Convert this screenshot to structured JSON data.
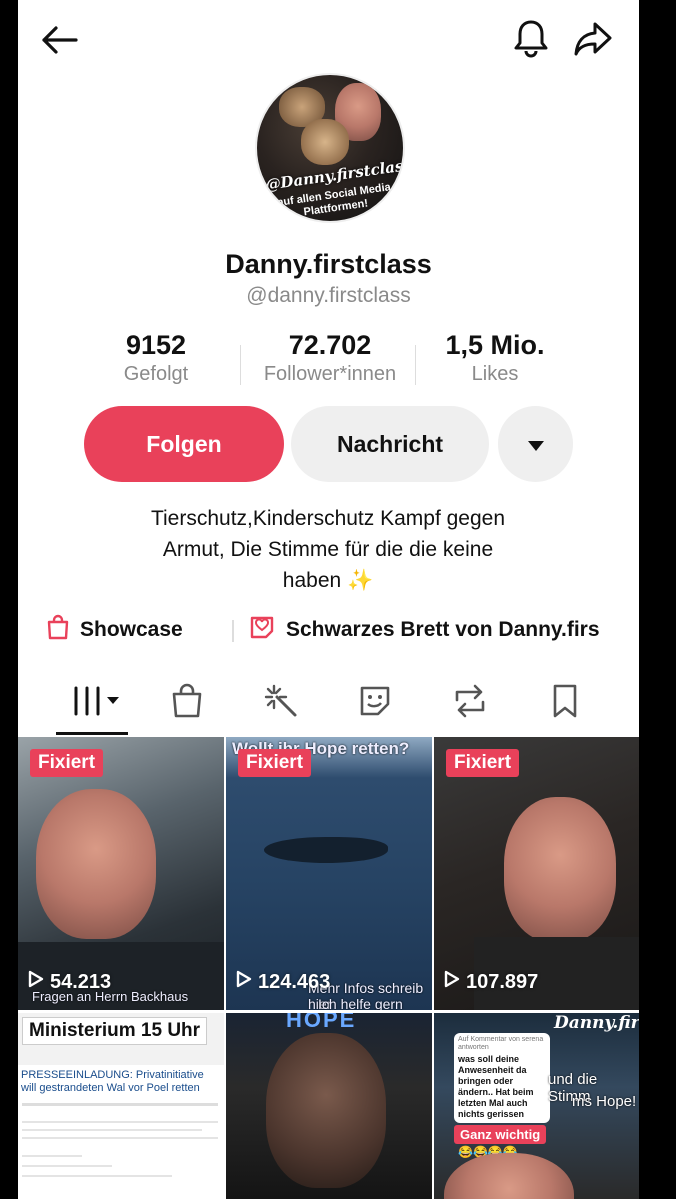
{
  "header": {
    "back_icon": "arrow-left-icon",
    "bell_icon": "bell-icon",
    "share_icon": "share-arrow-icon"
  },
  "profile": {
    "avatar_logo_text": "@Danny.firstclass",
    "avatar_sub_text": "auf allen Social Media Plattformen!",
    "display_name": "Danny.firstclass",
    "handle": "@danny.firstclass"
  },
  "stats": [
    {
      "value": "9152",
      "label": "Gefolgt"
    },
    {
      "value": "72.702",
      "label": "Follower*innen"
    },
    {
      "value": "1,5 Mio.",
      "label": "Likes"
    }
  ],
  "actions": {
    "follow_label": "Folgen",
    "message_label": "Nachricht",
    "more_icon": "caret-down-icon"
  },
  "bio": {
    "line1": "Tierschutz,Kinderschutz Kampf gegen",
    "line2": "Armut,  Die Stimme für die die keine",
    "line3": "haben ✨"
  },
  "links": {
    "showcase_label": "Showcase",
    "board_label": "Schwarzes Brett von Danny.firs"
  },
  "tabs": [
    "videos-grid-icon",
    "shopping-bag-icon",
    "sparkle-wand-icon",
    "sticker-icon",
    "repost-icon",
    "bookmark-icon"
  ],
  "videos": [
    {
      "pinned": "Fixiert",
      "views": "54.213",
      "caption": "Fragen an Herrn Backhaus"
    },
    {
      "pinned": "Fixiert",
      "views": "124.463",
      "caption_top": "Wollt ihr Hope retten?",
      "caption": "Mehr Infos schreib hier",
      "caption2": "Ich helfe gern"
    },
    {
      "pinned": "Fixiert",
      "views": "107.897"
    },
    {
      "title": "Ministerium 15 Uhr",
      "doc_heading": "PRESSEEINLADUNG: Privatinitiative will gestrandeten Wal vor Poel retten"
    },
    {
      "caption_top": "HOPE"
    },
    {
      "comment_header": "Auf Kommentar von serena antworten",
      "comment_text": "was soll deine Anwesenheit da bringen oder ändern.. Hat beim letzten Mal auch nichts gerissen",
      "badge": "Ganz wichtig",
      "overlay_text": "und die Stimm",
      "overlay_text2": "ms Hope!",
      "brand": "Danny.firstclass"
    }
  ],
  "colors": {
    "accent": "#e9415a",
    "secondary_btn": "#efefef",
    "muted_text": "#8a8a8a"
  }
}
